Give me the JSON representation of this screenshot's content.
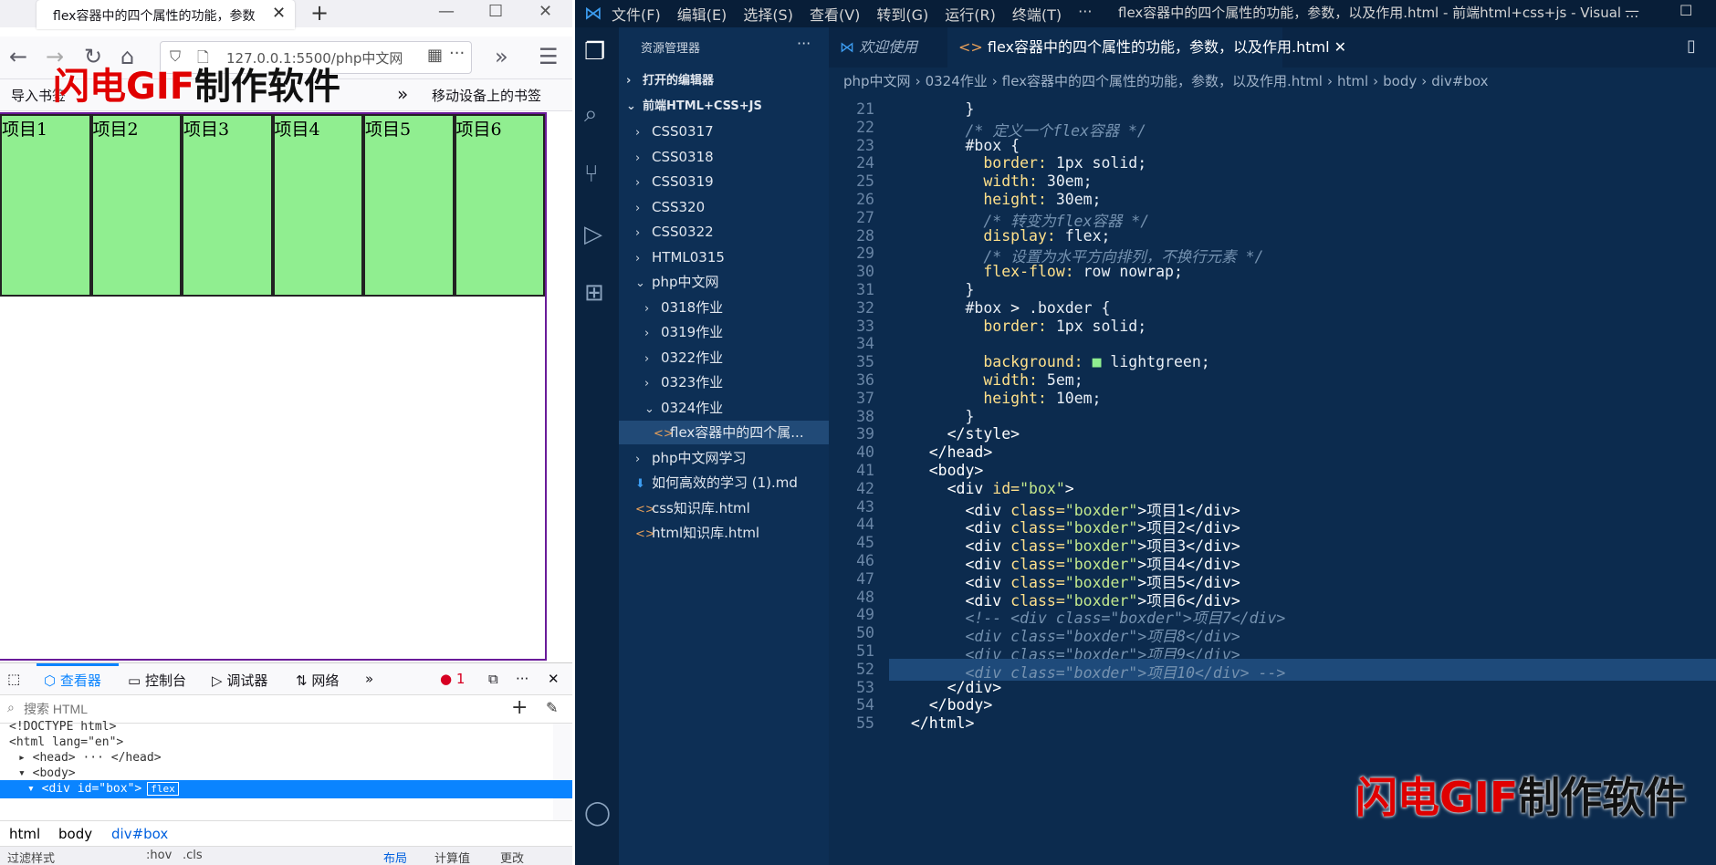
{
  "browser": {
    "tab_title": "flex容器中的四个属性的功能，参数",
    "url": "127.0.0.1:5500/php中文网",
    "bookmarks": [
      "导入书签",
      "移动设备上的书签"
    ],
    "watermark_red": "闪电GIF",
    "watermark_dark": "制作软件",
    "items": [
      "项目1",
      "项目2",
      "项目3",
      "项目4",
      "项目5",
      "项目6"
    ]
  },
  "devtools": {
    "tabs": [
      "查看器",
      "控制台",
      "调试器",
      "网络"
    ],
    "error_count": "1",
    "search_placeholder": "搜索 HTML",
    "tree": [
      {
        "indent": 1,
        "text": "<!DOCTYPE html>"
      },
      {
        "indent": 1,
        "text": "<html lang=\"en\">"
      },
      {
        "indent": 2,
        "text": "▸ <head> ··· </head>"
      },
      {
        "indent": 2,
        "text": "▾ <body>"
      },
      {
        "indent": 3,
        "text": "▾ <div id=\"box\">"
      }
    ],
    "flex_badge": "flex",
    "breadcrumb": [
      "html",
      "body",
      "div#box"
    ],
    "bottom_left": "过滤样式",
    "bottom_items": [
      ":hov",
      ".cls",
      "布局",
      "计算值",
      "更改"
    ]
  },
  "vscode": {
    "menu": [
      "文件(F)",
      "编辑(E)",
      "选择(S)",
      "查看(V)",
      "转到(G)",
      "运行(R)",
      "终端(T)",
      "···"
    ],
    "window_title": "flex容器中的四个属性的功能，参数，以及作用.html - 前端html+css+js - Visual ...",
    "explorer_title": "资源管理器",
    "explorer_more": "···",
    "sidebar_tree": [
      {
        "indent": 0,
        "icon": "›",
        "label": "打开的编辑器",
        "bold": true
      },
      {
        "indent": 0,
        "icon": "⌄",
        "label": "前端HTML+CSS+JS",
        "bold": true
      },
      {
        "indent": 1,
        "icon": "›",
        "label": "CSS0317"
      },
      {
        "indent": 1,
        "icon": "›",
        "label": "CSS0318"
      },
      {
        "indent": 1,
        "icon": "›",
        "label": "CSS0319"
      },
      {
        "indent": 1,
        "icon": "›",
        "label": "CSS320"
      },
      {
        "indent": 1,
        "icon": "›",
        "label": "CSS0322"
      },
      {
        "indent": 1,
        "icon": "›",
        "label": "HTML0315"
      },
      {
        "indent": 1,
        "icon": "⌄",
        "label": "php中文网"
      },
      {
        "indent": 2,
        "icon": "›",
        "label": "0318作业"
      },
      {
        "indent": 2,
        "icon": "›",
        "label": "0319作业"
      },
      {
        "indent": 2,
        "icon": "›",
        "label": "0322作业"
      },
      {
        "indent": 2,
        "icon": "›",
        "label": "0323作业"
      },
      {
        "indent": 2,
        "icon": "⌄",
        "label": "0324作业"
      },
      {
        "indent": 3,
        "icon": "<>",
        "label": "flex容器中的四个属...",
        "selected": true
      },
      {
        "indent": 1,
        "icon": "›",
        "label": "php中文网学习"
      },
      {
        "indent": 1,
        "icon": "⬇",
        "label": "如何高效的学习 (1).md"
      },
      {
        "indent": 1,
        "icon": "<>",
        "label": "css知识库.html"
      },
      {
        "indent": 1,
        "icon": "<>",
        "label": "html知识库.html"
      }
    ],
    "tabs": [
      "欢迎使用",
      "flex容器中的四个属性的功能，参数，以及作用.html"
    ],
    "breadcrumbs": [
      "php中文网",
      "0324作业",
      "flex容器中的四个属性的功能，参数，以及作用.html",
      "html",
      "body",
      "div#box"
    ],
    "code": [
      {
        "n": "21",
        "t": "        }"
      },
      {
        "n": "22",
        "t": "        /* 定义一个flex容器 */"
      },
      {
        "n": "23",
        "t": "        #box {"
      },
      {
        "n": "24",
        "t": "          border: 1px solid;"
      },
      {
        "n": "25",
        "t": "          width: 30em;"
      },
      {
        "n": "26",
        "t": "          height: 30em;"
      },
      {
        "n": "27",
        "t": "          /* 转变为flex容器 */"
      },
      {
        "n": "28",
        "t": "          display: flex;"
      },
      {
        "n": "29",
        "t": "          /* 设置为水平方向排列，不换行元素 */"
      },
      {
        "n": "30",
        "t": "          flex-flow: row nowrap;"
      },
      {
        "n": "31",
        "t": "        }"
      },
      {
        "n": "32",
        "t": "        #box > .boxder {"
      },
      {
        "n": "33",
        "t": "          border: 1px solid;"
      },
      {
        "n": "34",
        "t": ""
      },
      {
        "n": "35",
        "t": "          background: ■ lightgreen;"
      },
      {
        "n": "36",
        "t": "          width: 5em;"
      },
      {
        "n": "37",
        "t": "          height: 10em;"
      },
      {
        "n": "38",
        "t": "        }"
      },
      {
        "n": "39",
        "t": "      </style>"
      },
      {
        "n": "40",
        "t": "    </head>"
      },
      {
        "n": "41",
        "t": "    <body>"
      },
      {
        "n": "42",
        "t": "      <div id=\"box\">"
      },
      {
        "n": "43",
        "t": "        <div class=\"boxder\">项目1</div>"
      },
      {
        "n": "44",
        "t": "        <div class=\"boxder\">项目2</div>"
      },
      {
        "n": "45",
        "t": "        <div class=\"boxder\">项目3</div>"
      },
      {
        "n": "46",
        "t": "        <div class=\"boxder\">项目4</div>"
      },
      {
        "n": "47",
        "t": "        <div class=\"boxder\">项目5</div>"
      },
      {
        "n": "48",
        "t": "        <div class=\"boxder\">项目6</div>"
      },
      {
        "n": "49",
        "t": "        <!-- <div class=\"boxder\">项目7</div>"
      },
      {
        "n": "50",
        "t": "        <div class=\"boxder\">项目8</div>"
      },
      {
        "n": "51",
        "t": "        <div class=\"boxder\">项目9</div>"
      },
      {
        "n": "52",
        "t": "        <div class=\"boxder\">项目10</div> -->"
      },
      {
        "n": "53",
        "t": "      </div>"
      },
      {
        "n": "54",
        "t": "    </body>"
      },
      {
        "n": "55",
        "t": "  </html>"
      }
    ],
    "active_line": "52",
    "watermark_red": "闪电GIF",
    "watermark_dark": "制作软件"
  },
  "colors": {
    "lightgreen": "#90ee90",
    "box_border": "#6a1b9a",
    "vscode_bg": "#0c2b4e"
  }
}
